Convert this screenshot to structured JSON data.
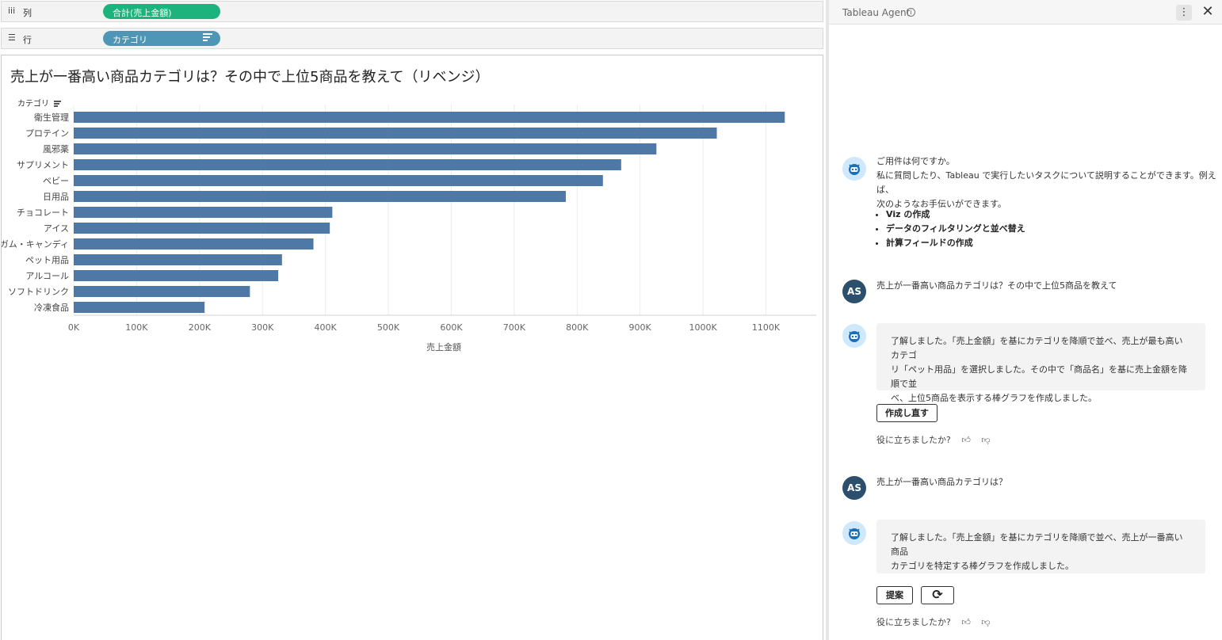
{
  "shelves": {
    "columns": {
      "icon": "columns-icon",
      "label": "列",
      "pill": "合計(売上金額)"
    },
    "rows": {
      "icon": "rows-icon",
      "label": "行",
      "pill": "カテゴリ"
    }
  },
  "viz": {
    "title": "売上が一番高い商品カテゴリは？その中で上位5商品を教えて（リベンジ）",
    "row_header": "カテゴリ"
  },
  "chart_data": {
    "type": "bar",
    "orientation": "horizontal",
    "categories": [
      "衛生管理",
      "プロテイン",
      "風邪薬",
      "サプリメント",
      "ベビー",
      "日用品",
      "チョコレート",
      "アイス",
      "ガム・キャンディ",
      "ペット用品",
      "アルコール",
      "ソフトドリンク",
      "冷凍食品"
    ],
    "values": [
      1130000,
      1022000,
      926000,
      870000,
      841000,
      782000,
      411000,
      407000,
      381000,
      331000,
      325000,
      280000,
      208000
    ],
    "xlabel": "売上金額",
    "ylabel": "カテゴリ",
    "xlim": [
      0,
      1180000
    ],
    "xticks": [
      0,
      100000,
      200000,
      300000,
      400000,
      500000,
      600000,
      700000,
      800000,
      900000,
      1000000,
      1100000
    ],
    "xtick_labels": [
      "0K",
      "100K",
      "200K",
      "300K",
      "400K",
      "500K",
      "600K",
      "700K",
      "800K",
      "900K",
      "1000K",
      "1100K"
    ],
    "bar_color": "#4e79a7",
    "grid": true
  },
  "agent": {
    "title": "Tableau Agent",
    "info_icon": "info-icon",
    "more_icon": "more-options-icon",
    "close_icon": "close-icon",
    "greeting": {
      "line1": "ご用件は何ですか。",
      "line2": "私に質問したり、Tableau で実行したいタスクについて説明することができます。例えば、",
      "line3": "次のようなお手伝いができます。",
      "bullets": [
        "Viz の作成",
        "データのフィルタリングと並べ替え",
        "計算フィールドの作成"
      ]
    },
    "messages": [
      {
        "user_initials": "AS",
        "user_text": "売上が一番高い商品カテゴリは？その中で上位5商品を教えて",
        "reply_line1": "了解しました。「売上金額」を基にカテゴリを降順で並べ、売上が最も高いカテゴ",
        "reply_line2": "リ「ペット用品」を選択しました。その中で「商品名」を基に売上金額を降順で並",
        "reply_line3": "べ、上位5商品を表示する棒グラフを作成しました。",
        "button": "作成し直す",
        "feedback": "役に立ちましたか?"
      },
      {
        "user_initials": "AS",
        "user_text": "売上が一番高い商品カテゴリは？",
        "reply_line1": "了解しました。「売上金額」を基にカテゴリを降順で並べ、売上が一番高い商品",
        "reply_line2": "カテゴリを特定する棒グラフを作成しました。",
        "button": "提案",
        "feedback": "役に立ちましたか?"
      }
    ]
  }
}
